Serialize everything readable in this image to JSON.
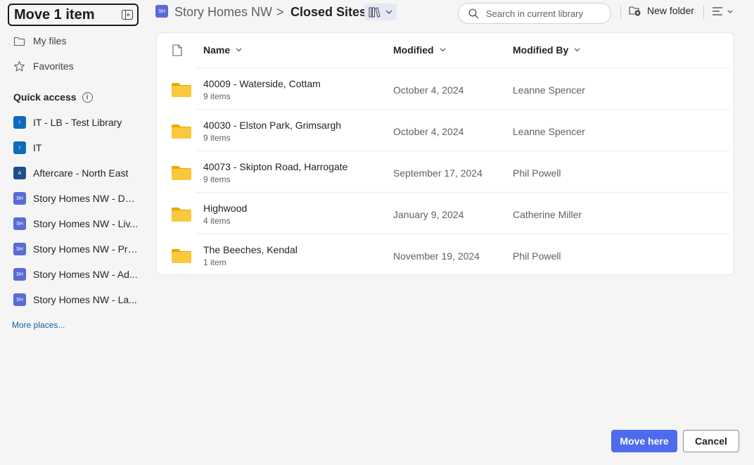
{
  "dialog": {
    "title": "Move 1 item"
  },
  "nav": {
    "my_files": "My files",
    "favorites": "Favorites"
  },
  "quick_access": {
    "label": "Quick access",
    "info": "i",
    "items": [
      {
        "badge": "I",
        "badge_color": "#0f6cbd",
        "label": "IT - LB - Test Library"
      },
      {
        "badge": "I",
        "badge_color": "#0f6cbd",
        "label": "IT"
      },
      {
        "badge": "A",
        "badge_color": "#1e4f8a",
        "label": "Aftercare - North East"
      },
      {
        "badge": "SH",
        "badge_color": "#5a6bd8",
        "label": "Story Homes NW - De..."
      },
      {
        "badge": "SH",
        "badge_color": "#5a6bd8",
        "label": "Story Homes NW - Liv..."
      },
      {
        "badge": "SH",
        "badge_color": "#5a6bd8",
        "label": "Story Homes NW - Pre..."
      },
      {
        "badge": "SH",
        "badge_color": "#5a6bd8",
        "label": "Story Homes NW - Ad..."
      },
      {
        "badge": "SH",
        "badge_color": "#5a6bd8",
        "label": "Story Homes NW - La..."
      }
    ],
    "more_places": "More places..."
  },
  "breadcrumb": {
    "badge": "SH",
    "root": "Story Homes NW",
    "separator": ">",
    "current": "Closed Sites"
  },
  "search": {
    "placeholder": "Search in current library"
  },
  "toolbar": {
    "new_folder": "New folder"
  },
  "table": {
    "headers": {
      "name": "Name",
      "modified": "Modified",
      "modified_by": "Modified By"
    },
    "rows": [
      {
        "name": "40009 - Waterside, Cottam",
        "count": "9 items",
        "modified": "October 4, 2024",
        "modified_by": "Leanne Spencer"
      },
      {
        "name": "40030 - Elston Park, Grimsargh",
        "count": "9 items",
        "modified": "October 4, 2024",
        "modified_by": "Leanne Spencer"
      },
      {
        "name": "40073 - Skipton Road, Harrogate",
        "count": "9 items",
        "modified": "September 17, 2024",
        "modified_by": "Phil Powell"
      },
      {
        "name": "Highwood",
        "count": "4 items",
        "modified": "January 9, 2024",
        "modified_by": "Catherine Miller"
      },
      {
        "name": "The Beeches, Kendal",
        "count": "1 item",
        "modified": "November 19, 2024",
        "modified_by": "Phil Powell"
      }
    ]
  },
  "footer": {
    "move_here": "Move here",
    "cancel": "Cancel"
  },
  "colors": {
    "accent": "#4f6bed",
    "folder": "#f8c93c"
  }
}
